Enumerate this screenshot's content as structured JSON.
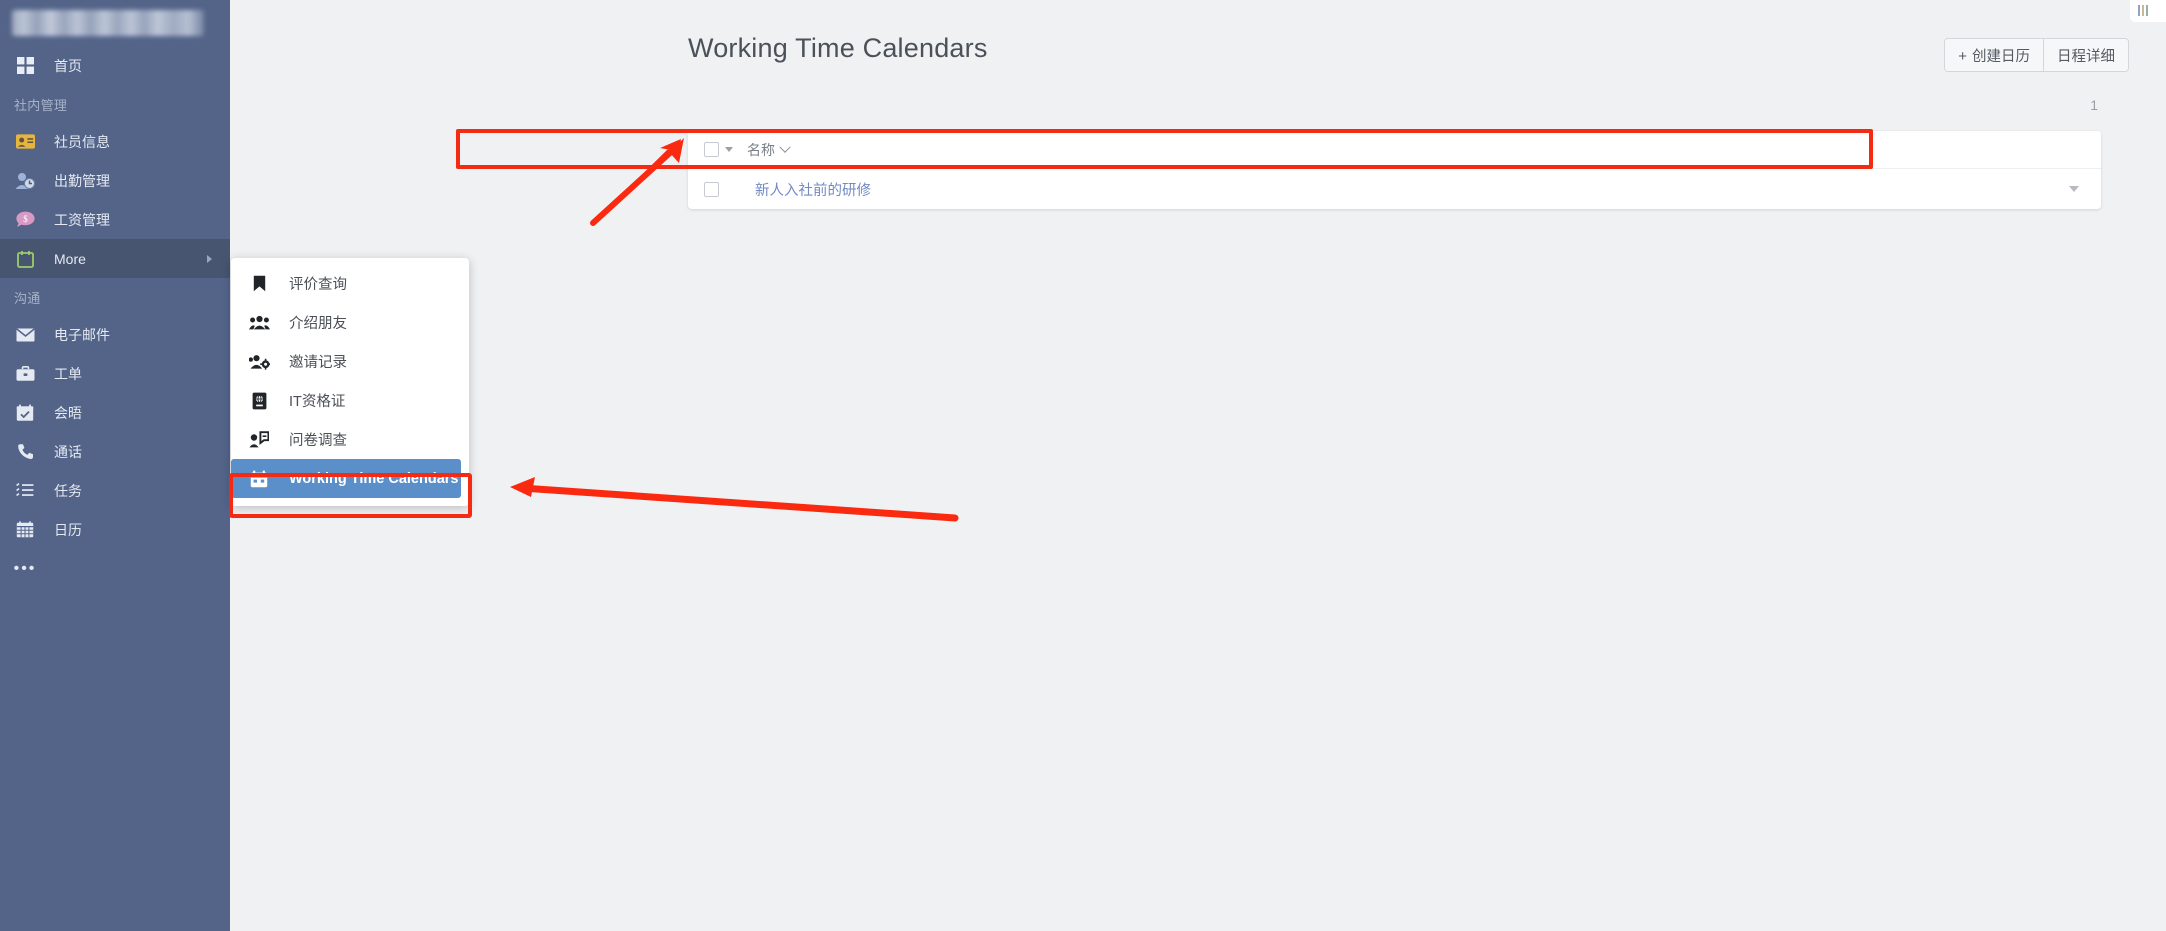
{
  "sidebar": {
    "logo_alt": "company-logo-blurred",
    "home": {
      "label": "首页",
      "icon": "grid-icon"
    },
    "sections": [
      {
        "title": "社内管理",
        "items": [
          {
            "label": "社员信息",
            "icon": "id-card-icon"
          },
          {
            "label": "出勤管理",
            "icon": "user-clock-icon"
          },
          {
            "label": "工资管理",
            "icon": "money-chat-icon"
          },
          {
            "label": "More",
            "icon": "calendar-outline-icon",
            "active": true,
            "has_submenu": true
          }
        ]
      },
      {
        "title": "沟通",
        "items": [
          {
            "label": "电子邮件",
            "icon": "envelope-icon"
          },
          {
            "label": "工单",
            "icon": "briefcase-icon"
          },
          {
            "label": "会晤",
            "icon": "calendar-check-icon"
          },
          {
            "label": "通话",
            "icon": "phone-icon"
          },
          {
            "label": "任务",
            "icon": "task-list-icon"
          },
          {
            "label": "日历",
            "icon": "calendar-icon"
          }
        ]
      }
    ],
    "more_label": "•••"
  },
  "submenu": {
    "items": [
      {
        "label": "评价查询",
        "icon": "bookmark-icon",
        "selected": false
      },
      {
        "label": "介绍朋友",
        "icon": "users-icon",
        "selected": false
      },
      {
        "label": "邀请记录",
        "icon": "users-cog-icon",
        "selected": false
      },
      {
        "label": "IT资格证",
        "icon": "passport-icon",
        "selected": false
      },
      {
        "label": "问卷调查",
        "icon": "survey-icon",
        "selected": false
      },
      {
        "label": "Working Time Calendars",
        "icon": "calendar-days-icon",
        "selected": true
      }
    ]
  },
  "header": {
    "title": "Working Time Calendars",
    "buttons": [
      {
        "label": "创建日历",
        "icon": "plus-icon"
      },
      {
        "label": "日程详细",
        "icon": ""
      }
    ]
  },
  "list": {
    "count": "1",
    "columns": [
      "名称"
    ],
    "rows": [
      {
        "name": "新人入社前的研修"
      }
    ]
  },
  "colors": {
    "sidebar_bg": "#546489",
    "sidebar_active": "#475571",
    "accent_blue": "#5b8fc9",
    "link_blue": "#7289c4",
    "highlight_red": "#f52a12",
    "page_bg": "#f0f1f3",
    "title_text": "#4a5158"
  }
}
